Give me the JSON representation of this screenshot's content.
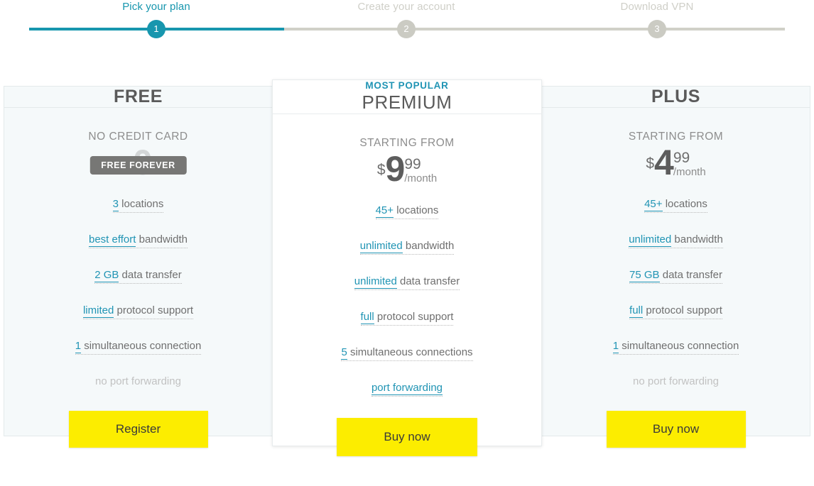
{
  "stepper": {
    "steps": [
      {
        "number": "1",
        "label": "Pick your plan",
        "state": "active"
      },
      {
        "number": "2",
        "label": "Create your account",
        "state": "inactive"
      },
      {
        "number": "3",
        "label": "Download VPN",
        "state": "inactive"
      }
    ],
    "accent_color": "#1796ae",
    "inactive_color": "#cfcfc8"
  },
  "plans": [
    {
      "id": "free",
      "eyebrow": "",
      "name": "FREE",
      "price_caption": "NO CREDIT CARD",
      "currency": "$",
      "amount": "0",
      "cents": "",
      "period": "",
      "badge": "FREE FOREVER",
      "features": [
        {
          "highlight": "3",
          "rest": " locations",
          "state": "enabled"
        },
        {
          "highlight": "best effort",
          "rest": " bandwidth",
          "state": "enabled"
        },
        {
          "highlight": "2 GB",
          "rest": " data transfer",
          "state": "enabled"
        },
        {
          "highlight": "limited",
          "rest": " protocol support",
          "state": "enabled"
        },
        {
          "highlight": "1",
          "rest": " simultaneous connection",
          "state": "enabled"
        },
        {
          "highlight": "",
          "rest": "no port forwarding",
          "state": "disabled"
        }
      ],
      "cta": "Register"
    },
    {
      "id": "premium",
      "eyebrow": "MOST POPULAR",
      "name": "PREMIUM",
      "price_caption": "STARTING FROM",
      "currency": "$",
      "amount": "9",
      "cents": "99",
      "period": "/month",
      "badge": "",
      "features": [
        {
          "highlight": "45+",
          "rest": " locations",
          "state": "enabled"
        },
        {
          "highlight": "unlimited",
          "rest": " bandwidth",
          "state": "enabled"
        },
        {
          "highlight": "unlimited",
          "rest": " data transfer",
          "state": "enabled"
        },
        {
          "highlight": "full",
          "rest": " protocol support",
          "state": "enabled"
        },
        {
          "highlight": "5",
          "rest": " simultaneous connections",
          "state": "enabled"
        },
        {
          "highlight": "port forwarding",
          "rest": "",
          "state": "enabled-all"
        }
      ],
      "cta": "Buy now"
    },
    {
      "id": "plus",
      "eyebrow": "",
      "name": "PLUS",
      "price_caption": "STARTING FROM",
      "currency": "$",
      "amount": "4",
      "cents": "99",
      "period": "/month",
      "badge": "",
      "features": [
        {
          "highlight": "45+",
          "rest": " locations",
          "state": "enabled"
        },
        {
          "highlight": "unlimited",
          "rest": " bandwidth",
          "state": "enabled"
        },
        {
          "highlight": "75 GB",
          "rest": " data transfer",
          "state": "enabled"
        },
        {
          "highlight": "full",
          "rest": " protocol support",
          "state": "enabled"
        },
        {
          "highlight": "1",
          "rest": " simultaneous connection",
          "state": "enabled"
        },
        {
          "highlight": "",
          "rest": "no port forwarding",
          "state": "disabled"
        }
      ],
      "cta": "Buy now"
    }
  ],
  "colors": {
    "accent": "#2094b4",
    "cta_bg": "#fced00",
    "card_bg": "#f5f9fa",
    "featured_bg": "#ffffff",
    "badge_bg": "#777775"
  }
}
